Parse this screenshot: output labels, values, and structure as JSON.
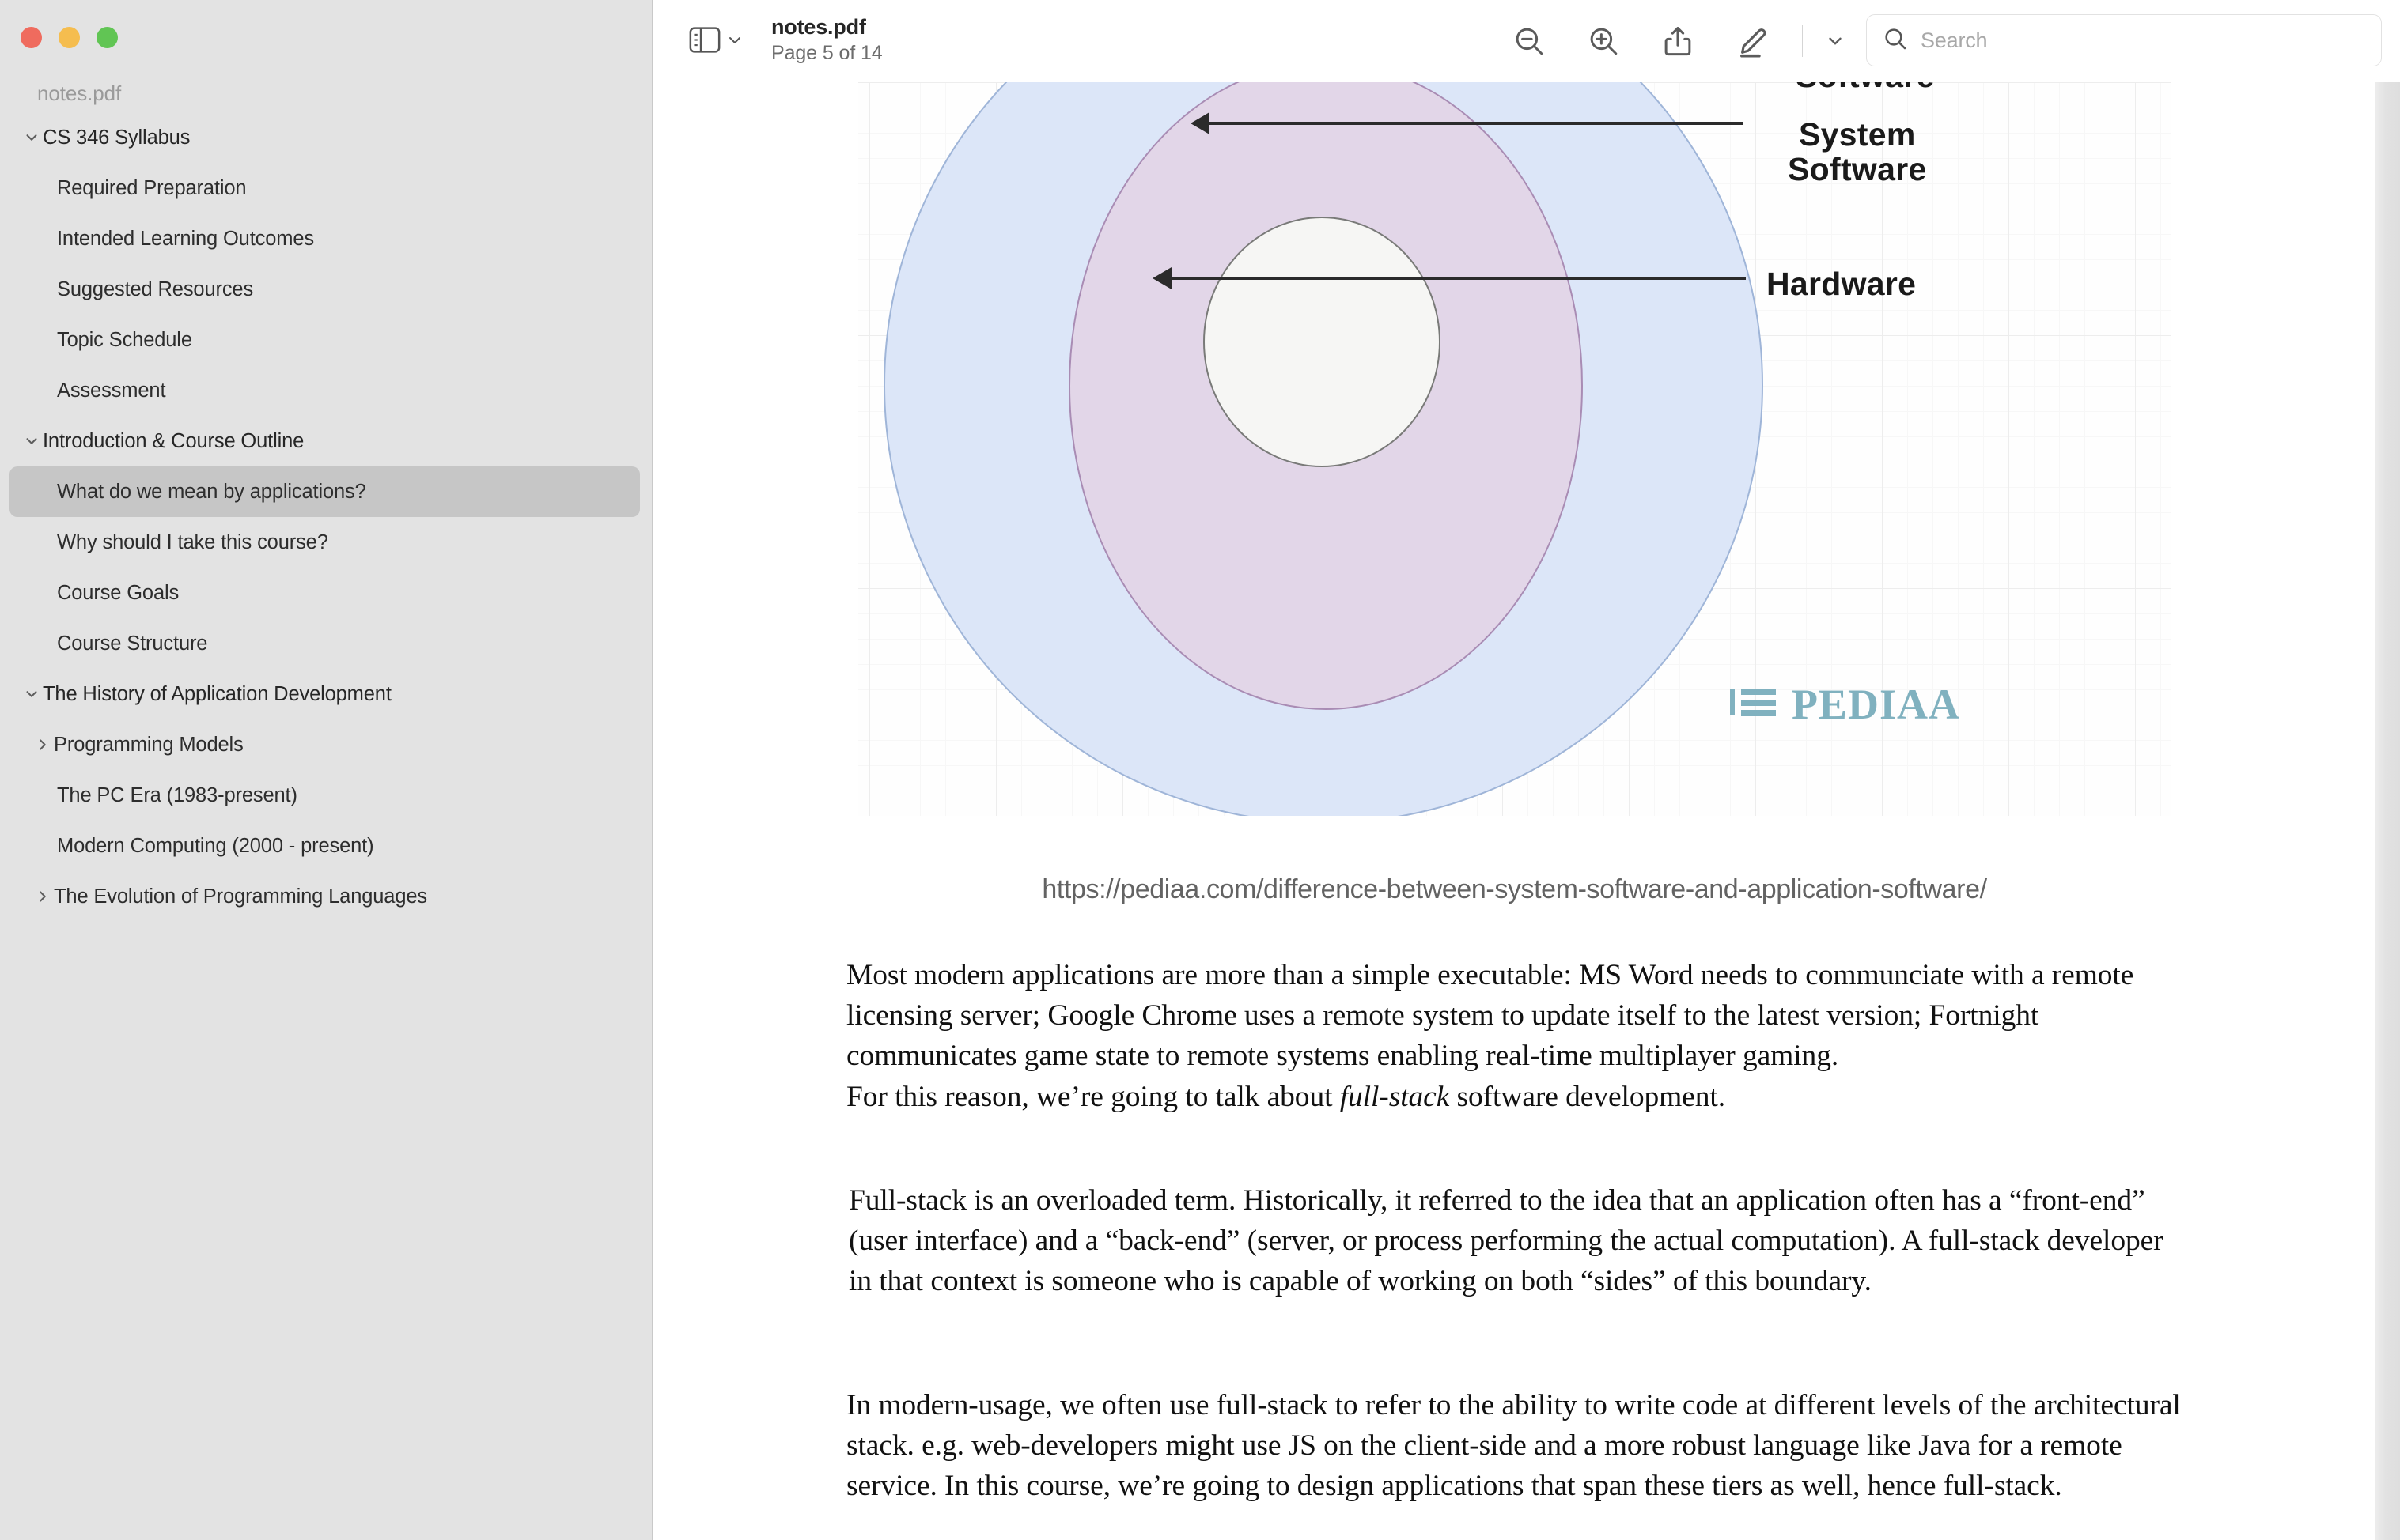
{
  "window": {
    "traffic_lights": [
      "close",
      "minimize",
      "maximize"
    ]
  },
  "sidebar": {
    "file_name": "notes.pdf",
    "outline": [
      {
        "label": "CS 346 Syllabus",
        "level": 0,
        "disclosure": "expanded",
        "selected": false
      },
      {
        "label": "Required Preparation",
        "level": 1,
        "disclosure": "none",
        "selected": false
      },
      {
        "label": "Intended Learning Outcomes",
        "level": 1,
        "disclosure": "none",
        "selected": false
      },
      {
        "label": "Suggested Resources",
        "level": 1,
        "disclosure": "none",
        "selected": false
      },
      {
        "label": "Topic Schedule",
        "level": 1,
        "disclosure": "none",
        "selected": false
      },
      {
        "label": "Assessment",
        "level": 1,
        "disclosure": "none",
        "selected": false
      },
      {
        "label": "Introduction & Course Outline",
        "level": 0,
        "disclosure": "expanded",
        "selected": false
      },
      {
        "label": "What do we mean by applications?",
        "level": 1,
        "disclosure": "none",
        "selected": true
      },
      {
        "label": "Why should I take this course?",
        "level": 1,
        "disclosure": "none",
        "selected": false
      },
      {
        "label": "Course Goals",
        "level": 1,
        "disclosure": "none",
        "selected": false
      },
      {
        "label": "Course Structure",
        "level": 1,
        "disclosure": "none",
        "selected": false
      },
      {
        "label": "The History of Application Development",
        "level": 0,
        "disclosure": "expanded",
        "selected": false
      },
      {
        "label": "Programming Models",
        "level": 2,
        "disclosure": "collapsed",
        "selected": false
      },
      {
        "label": "The PC Era (1983-present)",
        "level": 1,
        "disclosure": "none",
        "selected": false
      },
      {
        "label": "Modern Computing (2000 - present)",
        "level": 1,
        "disclosure": "none",
        "selected": false
      },
      {
        "label": "The Evolution of Programming Languages",
        "level": 2,
        "disclosure": "collapsed",
        "selected": false
      }
    ]
  },
  "toolbar": {
    "sidebar_toggle_icon": "sidebar-icon",
    "sidebar_toggle_chevron": "chevron-down-icon",
    "doc_title": "notes.pdf",
    "page_indicator": "Page 5 of 14",
    "buttons": [
      {
        "icon": "zoom-out-icon",
        "name": "zoom-out-button"
      },
      {
        "icon": "zoom-in-icon",
        "name": "zoom-in-button"
      },
      {
        "icon": "share-icon",
        "name": "share-button"
      },
      {
        "icon": "markup-pen-icon",
        "name": "markup-button"
      },
      {
        "icon": "chevron-down-icon",
        "name": "markup-options-button"
      },
      {
        "icon": "rotate-icon",
        "name": "rotate-button"
      },
      {
        "icon": "annotate-icon",
        "name": "annotate-button"
      }
    ],
    "search": {
      "placeholder": "Search",
      "value": "",
      "icon": "search-icon"
    }
  },
  "document": {
    "figure": {
      "labels": {
        "software": "Software",
        "system_software_line1": "System",
        "system_software_line2": "Software",
        "hardware": "Hardware"
      },
      "watermark": "PEDIAA",
      "caption": "https://pediaa.com/difference-between-system-software-and-application-software/",
      "colors": {
        "outer_ring_fill": "#dce6f8",
        "outer_ring_stroke": "#9fb5d8",
        "middle_ring_fill": "#e2d6e8",
        "middle_ring_stroke": "#a98cb4",
        "inner_circle_fill": "#f6f6f4",
        "inner_circle_stroke": "#797a78",
        "watermark_color": "#80b1bf"
      }
    },
    "paragraphs": {
      "p1": "Most modern applications are more than a simple executable: MS Word needs to communciate with a remote licensing server; Google Chrome uses a remote system to update itself to the latest version; Fortnight communicates game state to remote systems enabling real-time multiplayer gaming.",
      "p2_before": "For this reason, we’re going to talk about ",
      "p2_italic": "full-stack",
      "p2_after": " software development.",
      "p3": "Full-stack is an overloaded term.  Historically, it referred to the idea that an application often has a “front-end” (user interface) and a “back-end” (server, or process performing the actual computation). A full-stack developer in that context is someone who is capable of working on both “sides” of this boundary.",
      "p4": "In modern-usage, we often use full-stack to refer to the ability to write code at different levels of the architectural stack. e.g. web-developers might use JS on the client-side and a more robust language like Java for a remote service. In this course, we’re going to design applications that span these tiers as well, hence full-stack."
    }
  }
}
